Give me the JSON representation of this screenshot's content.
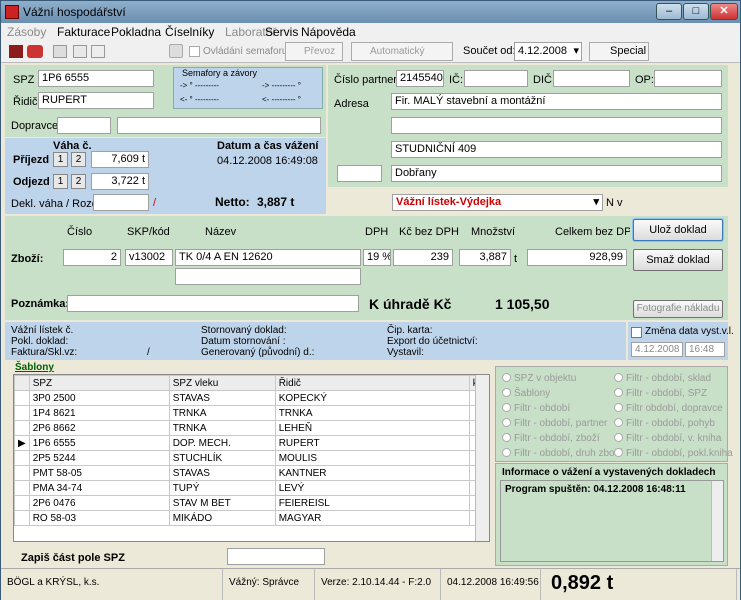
{
  "window": {
    "title": "Vážní hospodářství"
  },
  "menu": {
    "items": [
      "Zásoby",
      "Fakturace",
      "Pokladna",
      "Číselníky",
      "Laboratoř",
      "Servis",
      "Nápověda"
    ]
  },
  "toolbar": {
    "semafor_label": "Ovládání semaforu",
    "prevoz_label": "Převoz",
    "auto_label": "Automatický provoz",
    "soucet_label": "Součet od:",
    "soucet_date": "4.12.2008",
    "special_label": "Special"
  },
  "vehicle": {
    "spz_label": "SPZ",
    "spz_value": "1P6 6555",
    "ridic_label": "Řidič",
    "ridic_value": "RUPERT",
    "dopravce_label": "Dopravce:",
    "semafory_title": "Semafory a závory",
    "sem_line1_a": "-> ° ---------",
    "sem_line1_b": "-> --------- °",
    "sem_line2_a": "<- ° ---------",
    "sem_line2_b": "<- --------- °"
  },
  "partner": {
    "cislo_label": "Číslo partnera",
    "cislo_value": "2145540",
    "ic_label": "IČ:",
    "dic_label": "DIČ:",
    "op_label": "OP:",
    "adresa_label": "Adresa",
    "addr1": "Fir. MALÝ stavební a montážní",
    "addr2": "",
    "addr3": "STUDNIČNÍ 409",
    "addr4": "Dobřany"
  },
  "weigh": {
    "vaha_label": "Váha č.",
    "datum_label": "Datum a čas vážení",
    "datum_value": "04.12.2008 16:49:08",
    "prijezd_label": "Příjezd",
    "prijezd_value": "7,609 t",
    "odjezd_label": "Odjezd",
    "odjezd_value": "3,722 t",
    "btn1": "1",
    "btn2": "2",
    "netto_label": "Netto:",
    "netto_value": "3,887 t",
    "dekl_label": "Dekl. váha / Rozdíl",
    "slash": "/"
  },
  "doc_type": {
    "value": "Vážní lístek-Výdejka",
    "suffix": "N v"
  },
  "goods": {
    "h_cislo": "Číslo",
    "h_skp": "SKP/kód",
    "h_nazev": "Název",
    "h_dph": "DPH",
    "h_kc": "Kč  bez DPH",
    "h_mnozstvi": "Množství",
    "h_celkem": "Celkem bez DPH",
    "zbozi_label": "Zboží:",
    "cislo": "2",
    "skp": "v13002",
    "nazev": "TK 0/4 A EN 12620",
    "dph": "19 %",
    "kc": "239",
    "mnozstvi": "3,887",
    "unit": "t",
    "celkem": "928,99",
    "poznamka_label": "Poznámka:",
    "kuhrade_label": "K úhradě Kč",
    "kuhrade_value": "1 105,50"
  },
  "buttons": {
    "uloz": "Ulož doklad",
    "smaz": "Smaž doklad",
    "foto": "Fotografie nákladu"
  },
  "info": {
    "l1": "Vážní lístek č.",
    "l2": "Pokl. doklad:",
    "l3": "Faktura/Skl.vz:",
    "l3_slash": "/",
    "m1": "Stornovaný doklad:",
    "m2": "Datum stornování :",
    "m3": "Generovaný (původní) d.:",
    "r1": "Čip. karta:",
    "r2": "Export do účetnictví:",
    "r3": "Vystavil:",
    "zmena_label": "Změna data vyst.v.l.",
    "zmena_date": "4.12.2008",
    "zmena_time": "16:48"
  },
  "sablony": {
    "title": "Šablony",
    "columns": [
      "SPZ",
      "SPZ vleku",
      "Řidič",
      "k"
    ],
    "rows": [
      [
        "3P0 2500",
        "STAVAS",
        "KOPECKÝ"
      ],
      [
        "1P4 8621",
        "TRNKA",
        "TRNKA"
      ],
      [
        "2P6 8662",
        "TRNKA",
        "LEHEŇ"
      ],
      [
        "1P6 6555",
        "DOP. MECH.",
        "RUPERT"
      ],
      [
        "2P5 5244",
        "STUCHLÍK",
        "MOULIS"
      ],
      [
        "PMT 58-05",
        "STAVAS",
        "KANTNER"
      ],
      [
        "PMA 34-74",
        "TUPÝ",
        "LEVÝ"
      ],
      [
        "2P6 0476",
        "STAV M BET",
        "FEIEREISL"
      ],
      [
        "RO 58-03",
        "MIKÁDO",
        "MAGYAR"
      ]
    ],
    "zapis_label": "Zapiš část pole SPZ"
  },
  "filters": {
    "left": [
      "SPZ v objektu",
      "Šablony",
      "Filtr - období",
      "Filtr - období, partner",
      "Filtr - období, zboží",
      "Filtr - období, druh zboží"
    ],
    "right": [
      "Filtr - období, sklad",
      "Filtr - období, SPZ",
      "Filtr období, dopravce",
      "Filtr - období, pohyb",
      "Filtr - období, v. kniha",
      "Filtr - období, pokl.kniha"
    ]
  },
  "infobox": {
    "title": "Informace o vážení a vystavených dokladech",
    "text": "Program spuštěn: 04.12.2008 16:48:11"
  },
  "status": {
    "company": "BÖGL a KRÝSL, k.s.",
    "user": "Vážný: Správce",
    "version": "Verze: 2.10.14.44 - F:2.0",
    "datetime": "04.12.2008 16:49:56",
    "weight": "0,892 t"
  },
  "colors": {
    "green_panel": "#c8e0c8",
    "blue_panel": "#bed4ea",
    "doc_type_text": "#c00000"
  }
}
